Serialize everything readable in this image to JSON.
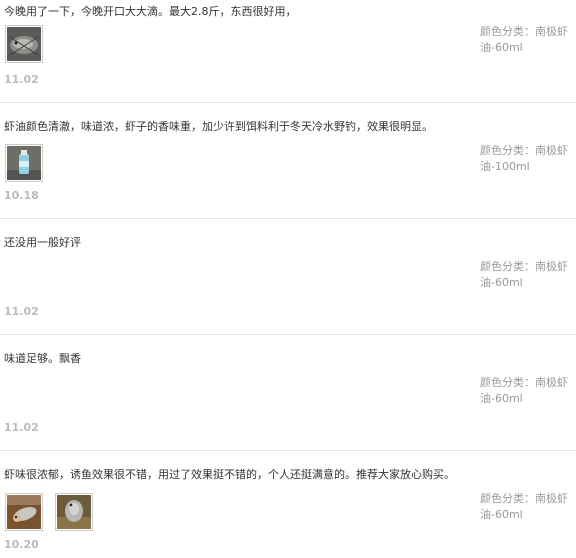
{
  "reviews": [
    {
      "text": "今晚用了一下，今晚开口大大滴。最大2.8斤，东西很好用，",
      "spec_key": "颜色分类：",
      "spec_value": "南极虾油-60ml",
      "date": "11.02",
      "thumbs": [
        "fish-in-net-photo"
      ]
    },
    {
      "text": "虾油颜色清澈，味道浓，虾子的香味重，加少许到饵料利于冬天冷水野钓，效果很明显。",
      "spec_key": "颜色分类：",
      "spec_value": "南极虾油-100ml",
      "date": "10.18",
      "thumbs": [
        "bottle-photo"
      ]
    },
    {
      "text": "还没用一般好评",
      "spec_key": "颜色分类：",
      "spec_value": "南极虾油-60ml",
      "date": "11.02",
      "thumbs": []
    },
    {
      "text": "味道足够。飘香",
      "spec_key": "颜色分类：",
      "spec_value": "南极虾油-60ml",
      "date": "11.02",
      "thumbs": []
    },
    {
      "text": "虾味很浓郁，诱鱼效果很不错，用过了效果挺不错的，个人还挺满意的。推荐大家放心购买。",
      "spec_key": "颜色分类：",
      "spec_value": "南极虾油-60ml",
      "date": "10.20",
      "thumbs": [
        "fish-catch-photo",
        "fish-on-ground-photo"
      ]
    }
  ]
}
